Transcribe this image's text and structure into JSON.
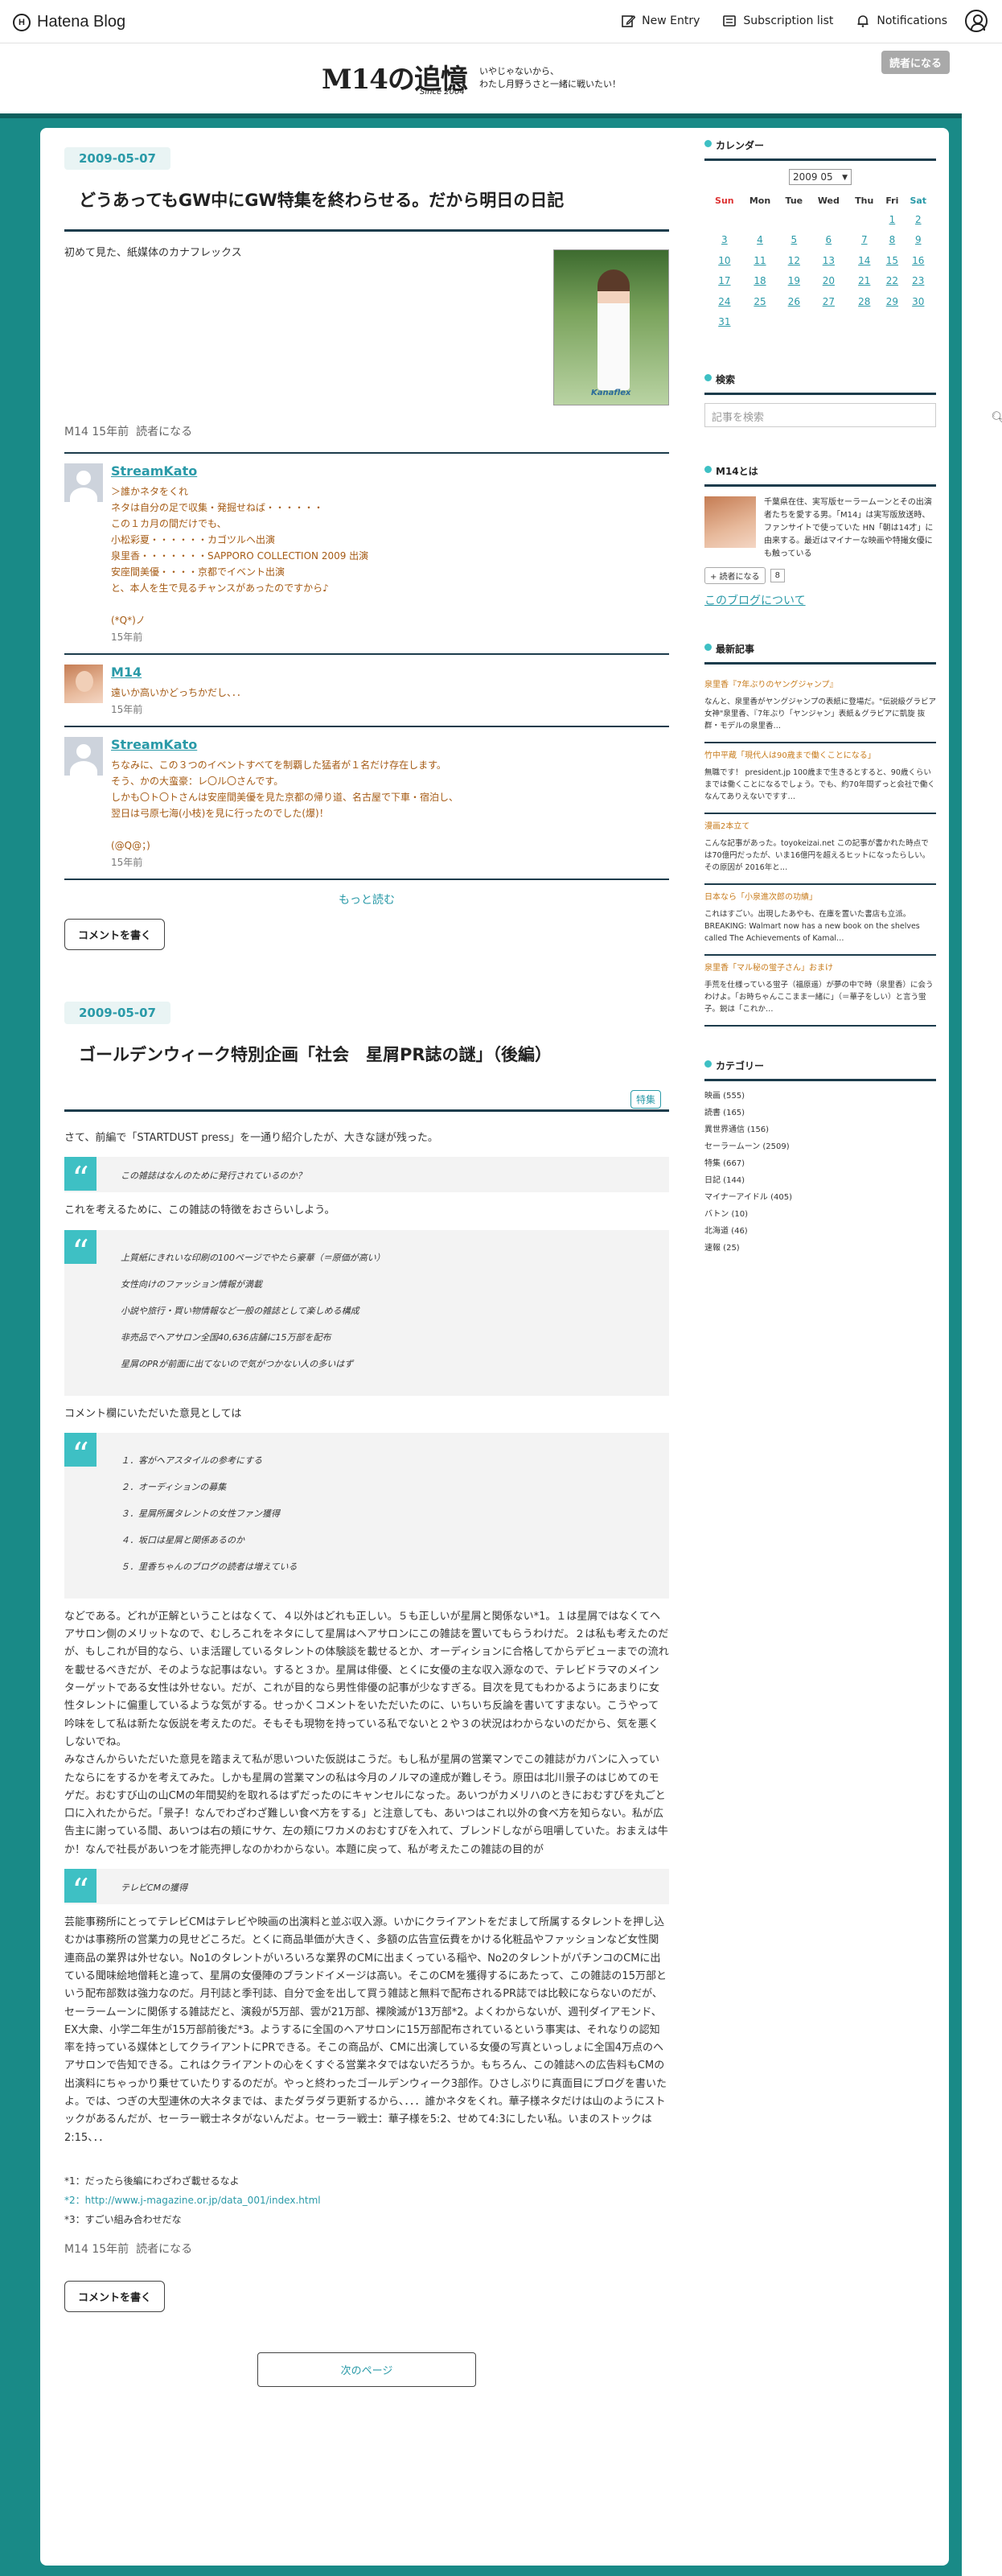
{
  "topbar": {
    "logo": "Hatena Blog",
    "new_entry": "New Entry",
    "subscription": "Subscription list",
    "notifications": "Notifications"
  },
  "header": {
    "title": "M14の追憶",
    "since": "Since 2004",
    "desc_line1": "いやじゃないから、",
    "desc_line2": "わたし月野うさと一緒に戦いたい！",
    "subscribe": "読者になる"
  },
  "entries": [
    {
      "date": "2009-05-07",
      "title": "どうあってもGW中にGW特集を終わらせる。だから明日の日記",
      "body": "初めて見た、紙媒体のカナフレックス",
      "image_caption": "Kanaflex",
      "author": "M14",
      "ago": "15年前",
      "subscribe": "読者になる",
      "comments": [
        {
          "name": "StreamKato",
          "lines": [
            "＞誰かネタをくれ",
            "ネタは自分の足で収集・発掘せねば・・・・・・",
            "この１カ月の間だけでも、",
            "小松彩夏・・・・・・カゴツルヘ出演",
            "泉里香・・・・・・・SAPPORO COLLECTION 2009 出演",
            "安座間美優・・・・京都でイベント出演",
            "と、本人を生で見るチャンスがあったのですから♪",
            "",
            "(*Q*)ノ"
          ],
          "time": "15年前"
        },
        {
          "name": "M14",
          "lines": [
            "遠いか高いかどっちかだし、．．"
          ],
          "time": "15年前"
        },
        {
          "name": "StreamKato",
          "lines": [
            "ちなみに、この３つのイベントすべてを制覇した猛者が１名だけ存在します。",
            "そう、かの大蛮豪：レ〇ル〇さんです。",
            "しかも〇ト〇トさんは安座間美優を見た京都の帰り道、名古屋で下車・宿泊し、",
            "翌日は弓原七海(小枝)を見に行ったのでした(爆)！",
            "",
            "(@Q@；)"
          ],
          "time": "15年前"
        }
      ],
      "more": "もっと読む",
      "comment_btn": "コメントを書く"
    },
    {
      "date": "2009-05-07",
      "title": "ゴールデンウィーク特別企画「社会　星屑PR誌の謎」（後編）",
      "tag": "特集",
      "p1": "さて、前編で「STARTDUST press」を一通り紹介したが、大きな謎が残った。",
      "q1": "この雑誌はなんのために発行されているのか？",
      "p2": "これを考えるために、この雑誌の特徴をおさらいしよう。",
      "q2": [
        "上質紙にきれいな印刷の100ページでやたら豪華（＝原価が高い）",
        "女性向けのファッション情報が満載",
        "小説や旅行・買い物情報など一般の雑誌として楽しめる構成",
        "非売品でヘアサロン全国40,636店舗に15万部を配布",
        "星屑のPRが前面に出てないので気がつかない人の多いはず"
      ],
      "p3": "コメント欄にいただいた意見としては",
      "q3": [
        "１．客がヘアスタイルの参考にする",
        "２．オーディションの募集",
        "３．星屑所属タレントの女性ファン獲得",
        "４．坂口は星屑と関係あるのか",
        "５．里香ちゃんのブログの読者は増えている"
      ],
      "p4": "などである。どれが正解ということはなくて、４以外はどれも正しい。５も正しいが星屑と関係ない*1。１は星屑ではなくてヘアサロン側のメリットなので、むしろこれをネタにして星屑はヘアサロンにこの雑誌を置いてもらうわけだ。２は私も考えたのだが、もしこれが目的なら、いま活躍しているタレントの体験談を載せるとか、オーディションに合格してからデビューまでの流れを載せるべきだが、そのような記事はない。すると３か。星屑は俳優、とくに女優の主な収入源なので、テレビドラマのメインターゲットである女性は外せない。だが、これが目的なら男性俳優の記事が少なすぎる。目次を見てもわかるようにあまりに女性タレントに偏重しているような気がする。せっかくコメントをいただいたのに、いちいち反論を書いてすまない。こうやって吟味をして私は新たな仮説を考えたのだ。そもそも現物を持っている私でないと２や３の状況はわからないのだから、気を悪くしないでね。",
      "p5": "みなさんからいただいた意見を踏まえて私が思いついた仮説はこうだ。もし私が星屑の営業マンでこの雑誌がカバンに入っていたならにをするかを考えてみた。しかも星屑の営業マンの私は今月のノルマの達成が難しそう。原田は北川景子のはじめてのモゲだ。おむすび山の山CMの年間契約を取れるはずだったのにキャンセルになった。あいつがカメリハのときにおむすびを丸ごと口に入れたからだ。「景子！なんでわざわざ難しい食べ方をする」と注意しても、あいつはこれ以外の食べ方を知らない。私が広告主に謝っている間、あいつは右の頬にサケ、左の頬にワカメのおむすびを入れて、ブレンドしながら咀嚼していた。おまえは牛か！なんで社長があいつを才能売押しなのかわからない。本題に戻って、私が考えたこの雑誌の目的が",
      "q4": "テレビCMの獲得",
      "p6": "芸能事務所にとってテレビCMはテレビや映画の出演料と並ぶ収入源。いかにクライアントをだまして所属するタレントを押し込むかは事務所の営業力の見せどころだ。とくに商品単価が大きく、多額の広告宣伝費をかける化粧品やファッションなど女性関連商品の業界は外せない。No1のタレントがいろいろな業界のCMに出まくっている稲や、No2のタレントがパチンコのCMに出ている聞味絵地僧耗と違って、星屑の女優陣のブランドイメージは高い。そこのCMを獲得するにあたって、この雑誌の15万部という配布部数は強力なのだ。月刊誌と季刊誌、自分で金を出して買う雑誌と無料で配布されるPR誌では比較にならないのだが、セーラームーンに関係する雑誌だと、演殺が5万部、雲が21万部、裸険滅が13万部*2。よくわからないが、週刊ダイアモンド、EX大衆、小学二年生が15万部前後だ*3。ようするに全国のヘアサロンに15万部配布されているという事実は、それなりの認知率を持っている媒体としてクライアントにPRできる。そこの商品が、CMに出演している女優の写真といっしょに全国4万点のヘアサロンで告知できる。これはクライアントの心をくすぐる営業ネタではないだろうか。もちろん、この雑誌への広告料もCMの出演料にちゃっかり乗せていたりするのだが。やっと終わったゴールデンウィーク3部作。ひさしぶりに真面目にブログを書いたよ。では、つぎの大型連休の大ネタまでは、またダラダラ更新するから、．．．誰かネタをくれ。華子様ネタだけは山のようにストックがあるんだが、セーラー戦士ネタがないんだよ。セーラー戦士：華子様を5:2、せめて4:3にしたい私。いまのストックは2:15、．．",
      "footnotes": [
        "*1：だったら後編にわざわざ載せるなよ",
        "*2：http://www.j-magazine.or.jp/data_001/index.html",
        "*3：すごい組み合わせだな"
      ],
      "author": "M14",
      "ago": "15年前",
      "subscribe": "読者になる",
      "comment_btn": "コメントを書く"
    }
  ],
  "next_page": "次のページ",
  "sidebar": {
    "calendar_title": "カレンダー",
    "month": "2009 05",
    "weekdays": [
      "Sun",
      "Mon",
      "Tue",
      "Wed",
      "Thu",
      "Fri",
      "Sat"
    ],
    "weeks": [
      [
        "",
        "",
        "",
        "",
        "",
        "1",
        "2"
      ],
      [
        "3",
        "4",
        "5",
        "6",
        "7",
        "8",
        "9"
      ],
      [
        "10",
        "11",
        "12",
        "13",
        "14",
        "15",
        "16"
      ],
      [
        "17",
        "18",
        "19",
        "20",
        "21",
        "22",
        "23"
      ],
      [
        "24",
        "25",
        "26",
        "27",
        "28",
        "29",
        "30"
      ],
      [
        "31",
        "",
        "",
        "",
        "",
        "",
        ""
      ]
    ],
    "search_title": "検索",
    "search_placeholder": "記事を検索",
    "about_title": "M14とは",
    "about_text": "千葉県在住、実写版セーラームーンとその出演者たちを愛する男。「M14」は実写版放送時、ファンサイトで使っていた HN「朝は14才」に由来する。最近はマイナーな映画や特撮女優にも触っている",
    "follow_btn": "読者になる",
    "follow_count": "8",
    "about_link": "このブログについて",
    "recent_title": "最新記事",
    "recent": [
      {
        "title": "泉里香『7年ぶりのヤングジャンプ』",
        "excerpt": "なんと、泉里香がヤングジャンプの表紙に登場だ。\"伝説級グラビア女神\"泉里香、『7年ぶり「ヤンジャン」表紙＆グラビアに凱旋 抜群・モデルの泉里香…"
      },
      {
        "title": "竹中平蔵「現代人は90歳まで働くことになる」",
        "excerpt": "無職です！ president.jp 100歳まで生きるとすると、90歳くらいまでは働くことになるでしょう。でも、約70年間ずっと会社で働くなんてありえないですす…"
      },
      {
        "title": "漫画2本立て",
        "excerpt": "こんな記事があった。toyokeizai.net この記事が書かれた時点では70億円だったが、いま16億円を超えるヒットになったらしい。その原因が 2016年と…"
      },
      {
        "title": "日本なら「小泉進次郎の功績」",
        "excerpt": "これはすごい。出現したあやも、在庫を置いた書店も立派。BREAKING: Walmart now has a new book on the shelves called The Achievements of Kamal…"
      },
      {
        "title": "泉里香「マル秘の蛍子さん」おまけ",
        "excerpt": "手荒を仕様っている蛍子（福原遥）が夢の中で時（泉里香）に会うわけよ。「お時ちゃんここまま一緒に」（＝華子をしい）と言う蛍子。鋭は「これか…"
      }
    ],
    "category_title": "カテゴリー",
    "categories": [
      "映画 (555)",
      "読書 (165)",
      "異世界通信 (156)",
      "セーラームーン (2509)",
      "特集 (667)",
      "日記 (144)",
      "マイナーアイドル (405)",
      "バトン (10)",
      "北海道 (46)",
      "速報 (25)"
    ]
  },
  "colors": {
    "accent": "#2a9aa8",
    "frame": "#198a87",
    "quote": "#3ec0c4"
  }
}
